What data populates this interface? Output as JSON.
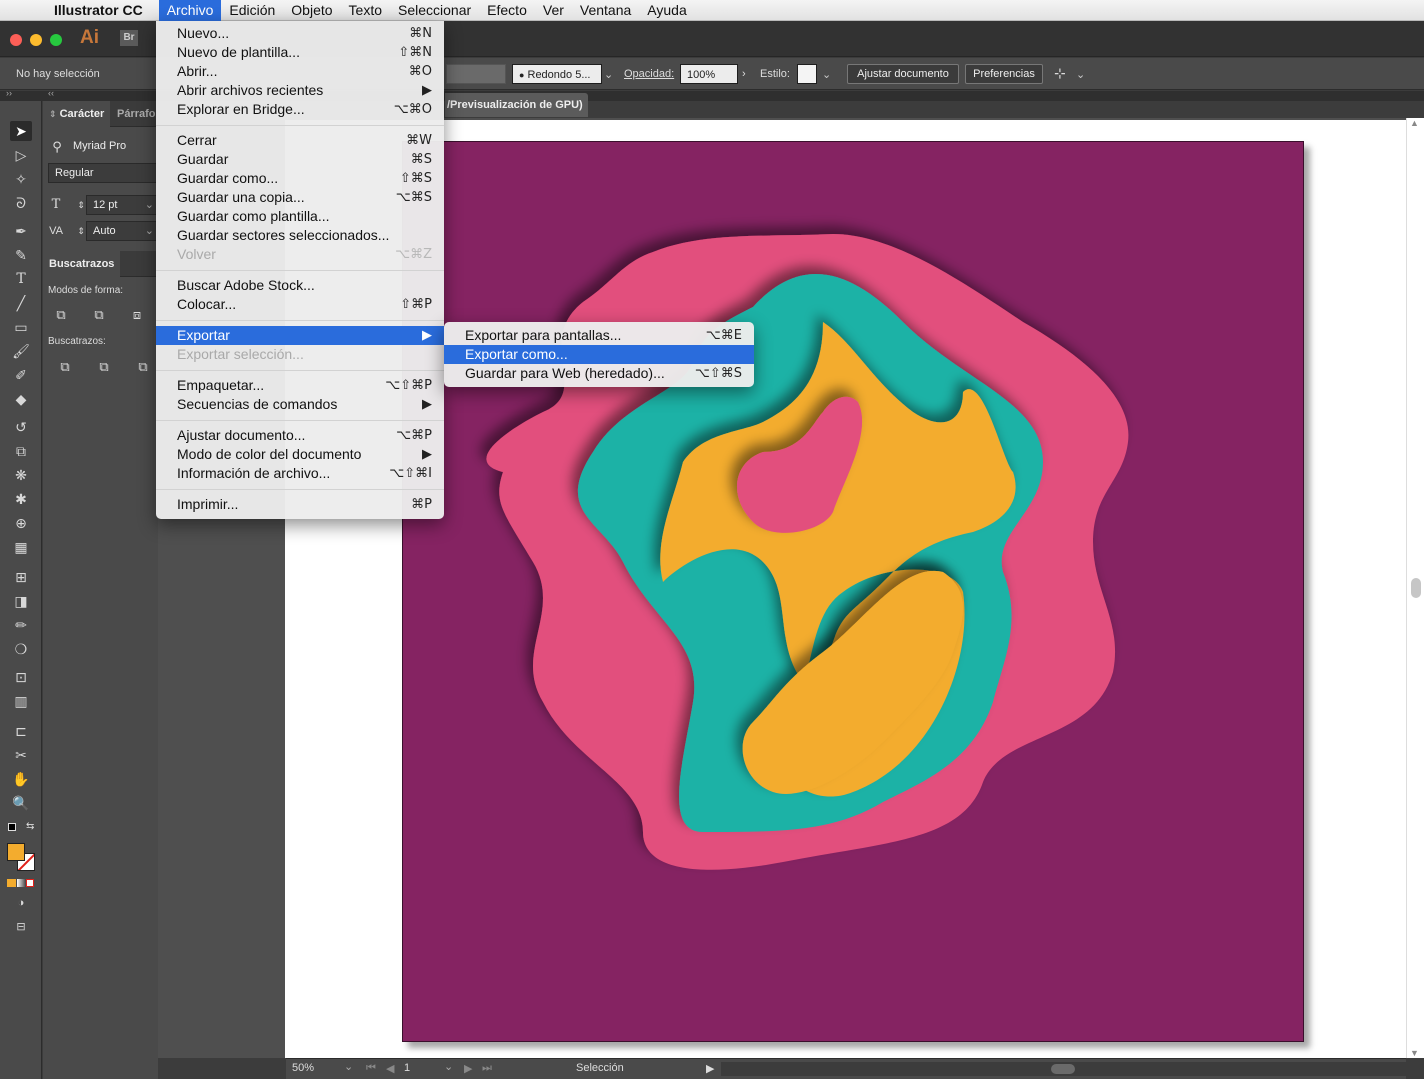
{
  "menubar": {
    "app_name": "Illustrator CC",
    "items": [
      "Archivo",
      "Edición",
      "Objeto",
      "Texto",
      "Seleccionar",
      "Efecto",
      "Ver",
      "Ventana",
      "Ayuda"
    ],
    "active": "Archivo"
  },
  "titlebar": {
    "ai_logo": "Ai",
    "br_logo": "Br"
  },
  "control": {
    "selection_status": "No hay selección",
    "brush": "Redondo 5...",
    "opacity_label": "Opacidad:",
    "opacity_value": "100%",
    "style_label": "Estilo:",
    "doc_setup_btn": "Ajustar documento",
    "prefs_btn": "Preferencias"
  },
  "doc_tab": "/Previsualización de GPU)",
  "character_panel": {
    "tab_active": "Carácter",
    "tab_other": "Párrafo",
    "font_family": "Myriad Pro",
    "font_style": "Regular",
    "font_size": "12 pt",
    "tracking": "Auto"
  },
  "pathfinder_panel": {
    "tab": "Buscatrazos",
    "shape_modes_label": "Modos de forma:",
    "pathfinders_label": "Buscatrazos:"
  },
  "file_menu": {
    "items": [
      {
        "label": "Nuevo...",
        "shortcut": "⌘N"
      },
      {
        "label": "Nuevo de plantilla...",
        "shortcut": "⇧⌘N"
      },
      {
        "label": "Abrir...",
        "shortcut": "⌘O"
      },
      {
        "label": "Abrir archivos recientes",
        "shortcut": "▶"
      },
      {
        "label": "Explorar en Bridge...",
        "shortcut": "⌥⌘O"
      },
      {
        "label": "Cerrar",
        "shortcut": "⌘W"
      },
      {
        "label": "Guardar",
        "shortcut": "⌘S"
      },
      {
        "label": "Guardar como...",
        "shortcut": "⇧⌘S"
      },
      {
        "label": "Guardar una copia...",
        "shortcut": "⌥⌘S"
      },
      {
        "label": "Guardar como plantilla...",
        "shortcut": ""
      },
      {
        "label": "Guardar sectores seleccionados...",
        "shortcut": ""
      },
      {
        "label": "Volver",
        "shortcut": "⌥⌘Z"
      },
      {
        "label": "Buscar Adobe Stock...",
        "shortcut": ""
      },
      {
        "label": "Colocar...",
        "shortcut": "⇧⌘P"
      },
      {
        "label": "Exportar",
        "shortcut": "▶"
      },
      {
        "label": "Exportar selección...",
        "shortcut": ""
      },
      {
        "label": "Empaquetar...",
        "shortcut": "⌥⇧⌘P"
      },
      {
        "label": "Secuencias de comandos",
        "shortcut": "▶"
      },
      {
        "label": "Ajustar documento...",
        "shortcut": "⌥⌘P"
      },
      {
        "label": "Modo de color del documento",
        "shortcut": "▶"
      },
      {
        "label": "Información de archivo...",
        "shortcut": "⌥⇧⌘I"
      },
      {
        "label": "Imprimir...",
        "shortcut": "⌘P"
      }
    ]
  },
  "export_submenu": {
    "items": [
      {
        "label": "Exportar para pantallas...",
        "shortcut": "⌥⌘E"
      },
      {
        "label": "Exportar como...",
        "shortcut": ""
      },
      {
        "label": "Guardar para Web (heredado)...",
        "shortcut": "⌥⇧⌘S"
      }
    ]
  },
  "statusbar": {
    "zoom": "50%",
    "page": "1",
    "tool": "Selección"
  },
  "colors": {
    "background": "#852362",
    "pink": "#e24f7d",
    "teal": "#1fb2a6",
    "yellow": "#f3ac2e",
    "fill_swatch": "#f3ac2e",
    "menu_highlight": "#2a6cdc"
  }
}
